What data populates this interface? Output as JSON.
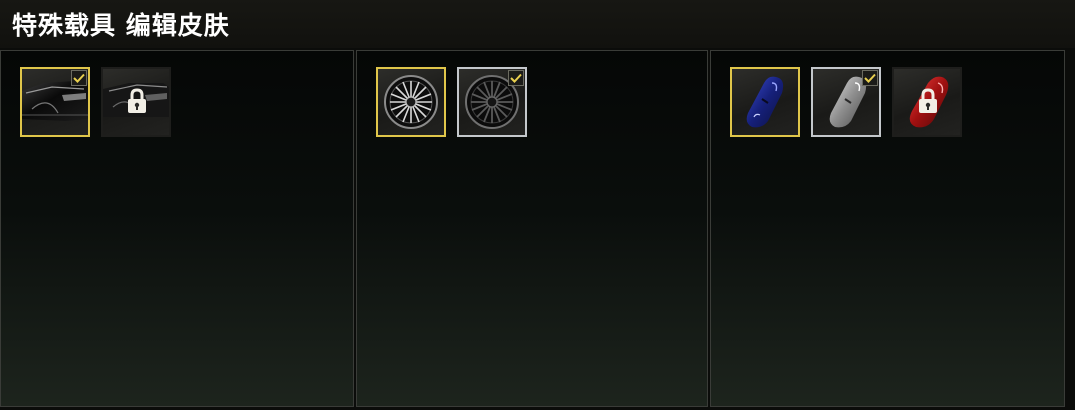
{
  "header": {
    "title": "特殊载具 编辑皮肤"
  },
  "colors": {
    "selected_border": "#e0c64a",
    "equipped_border": "#c4c8cc",
    "checkmark": "#e8cf4e",
    "panel_border": "#3a3c38"
  },
  "panels": [
    {
      "category": "body",
      "items": [
        {
          "icon": "car-body-black-icon",
          "state": "selected",
          "equipped": true,
          "locked": false
        },
        {
          "icon": "car-body-black-icon",
          "state": "plain",
          "equipped": false,
          "locked": true
        }
      ]
    },
    {
      "category": "wheels",
      "items": [
        {
          "icon": "wheel-silver-spoke-icon",
          "state": "selected",
          "equipped": false,
          "locked": false
        },
        {
          "icon": "wheel-black-spoke-icon",
          "state": "equipped",
          "equipped": true,
          "locked": false
        }
      ]
    },
    {
      "category": "brake-calipers",
      "items": [
        {
          "icon": "brake-caliper-blue-icon",
          "state": "selected",
          "equipped": false,
          "locked": false
        },
        {
          "icon": "brake-caliper-silver-icon",
          "state": "equipped",
          "equipped": true,
          "locked": false
        },
        {
          "icon": "brake-caliper-red-icon",
          "state": "plain",
          "equipped": false,
          "locked": true
        }
      ]
    }
  ]
}
